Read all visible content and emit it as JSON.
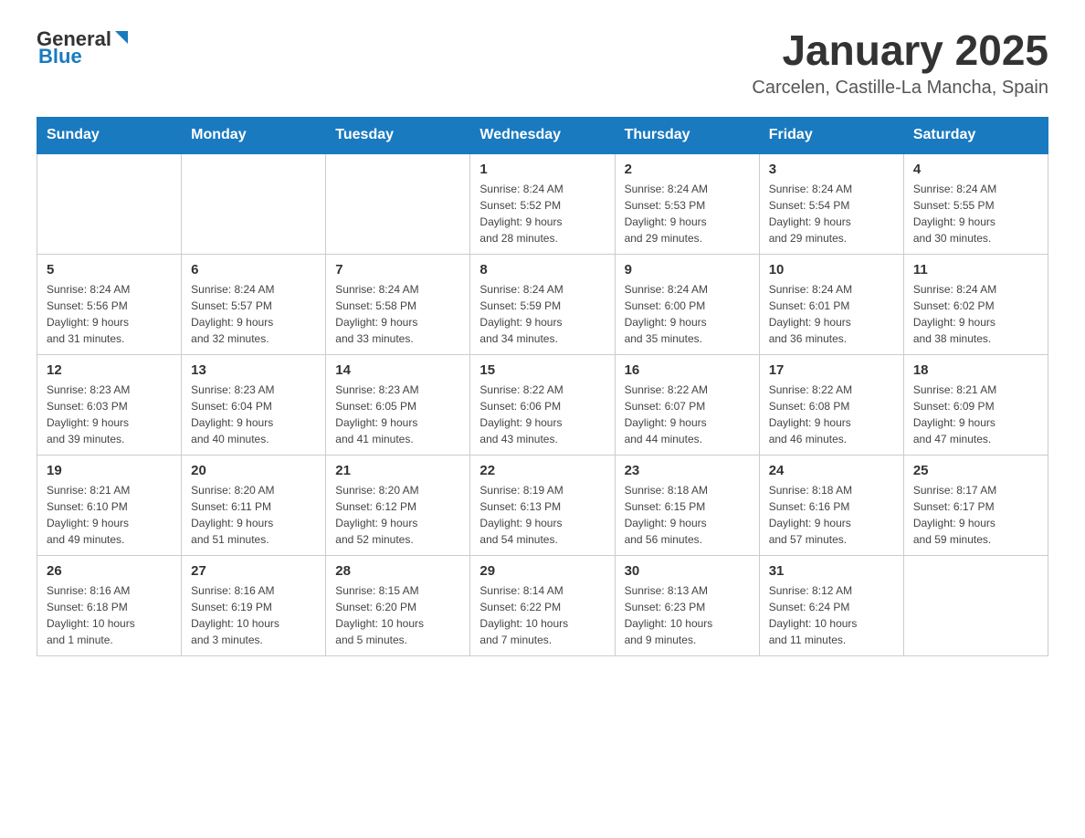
{
  "header": {
    "logo_text_general": "General",
    "logo_text_blue": "Blue",
    "title": "January 2025",
    "subtitle": "Carcelen, Castille-La Mancha, Spain"
  },
  "weekdays": [
    "Sunday",
    "Monday",
    "Tuesday",
    "Wednesday",
    "Thursday",
    "Friday",
    "Saturday"
  ],
  "weeks": [
    [
      {
        "day": "",
        "info": ""
      },
      {
        "day": "",
        "info": ""
      },
      {
        "day": "",
        "info": ""
      },
      {
        "day": "1",
        "info": "Sunrise: 8:24 AM\nSunset: 5:52 PM\nDaylight: 9 hours\nand 28 minutes."
      },
      {
        "day": "2",
        "info": "Sunrise: 8:24 AM\nSunset: 5:53 PM\nDaylight: 9 hours\nand 29 minutes."
      },
      {
        "day": "3",
        "info": "Sunrise: 8:24 AM\nSunset: 5:54 PM\nDaylight: 9 hours\nand 29 minutes."
      },
      {
        "day": "4",
        "info": "Sunrise: 8:24 AM\nSunset: 5:55 PM\nDaylight: 9 hours\nand 30 minutes."
      }
    ],
    [
      {
        "day": "5",
        "info": "Sunrise: 8:24 AM\nSunset: 5:56 PM\nDaylight: 9 hours\nand 31 minutes."
      },
      {
        "day": "6",
        "info": "Sunrise: 8:24 AM\nSunset: 5:57 PM\nDaylight: 9 hours\nand 32 minutes."
      },
      {
        "day": "7",
        "info": "Sunrise: 8:24 AM\nSunset: 5:58 PM\nDaylight: 9 hours\nand 33 minutes."
      },
      {
        "day": "8",
        "info": "Sunrise: 8:24 AM\nSunset: 5:59 PM\nDaylight: 9 hours\nand 34 minutes."
      },
      {
        "day": "9",
        "info": "Sunrise: 8:24 AM\nSunset: 6:00 PM\nDaylight: 9 hours\nand 35 minutes."
      },
      {
        "day": "10",
        "info": "Sunrise: 8:24 AM\nSunset: 6:01 PM\nDaylight: 9 hours\nand 36 minutes."
      },
      {
        "day": "11",
        "info": "Sunrise: 8:24 AM\nSunset: 6:02 PM\nDaylight: 9 hours\nand 38 minutes."
      }
    ],
    [
      {
        "day": "12",
        "info": "Sunrise: 8:23 AM\nSunset: 6:03 PM\nDaylight: 9 hours\nand 39 minutes."
      },
      {
        "day": "13",
        "info": "Sunrise: 8:23 AM\nSunset: 6:04 PM\nDaylight: 9 hours\nand 40 minutes."
      },
      {
        "day": "14",
        "info": "Sunrise: 8:23 AM\nSunset: 6:05 PM\nDaylight: 9 hours\nand 41 minutes."
      },
      {
        "day": "15",
        "info": "Sunrise: 8:22 AM\nSunset: 6:06 PM\nDaylight: 9 hours\nand 43 minutes."
      },
      {
        "day": "16",
        "info": "Sunrise: 8:22 AM\nSunset: 6:07 PM\nDaylight: 9 hours\nand 44 minutes."
      },
      {
        "day": "17",
        "info": "Sunrise: 8:22 AM\nSunset: 6:08 PM\nDaylight: 9 hours\nand 46 minutes."
      },
      {
        "day": "18",
        "info": "Sunrise: 8:21 AM\nSunset: 6:09 PM\nDaylight: 9 hours\nand 47 minutes."
      }
    ],
    [
      {
        "day": "19",
        "info": "Sunrise: 8:21 AM\nSunset: 6:10 PM\nDaylight: 9 hours\nand 49 minutes."
      },
      {
        "day": "20",
        "info": "Sunrise: 8:20 AM\nSunset: 6:11 PM\nDaylight: 9 hours\nand 51 minutes."
      },
      {
        "day": "21",
        "info": "Sunrise: 8:20 AM\nSunset: 6:12 PM\nDaylight: 9 hours\nand 52 minutes."
      },
      {
        "day": "22",
        "info": "Sunrise: 8:19 AM\nSunset: 6:13 PM\nDaylight: 9 hours\nand 54 minutes."
      },
      {
        "day": "23",
        "info": "Sunrise: 8:18 AM\nSunset: 6:15 PM\nDaylight: 9 hours\nand 56 minutes."
      },
      {
        "day": "24",
        "info": "Sunrise: 8:18 AM\nSunset: 6:16 PM\nDaylight: 9 hours\nand 57 minutes."
      },
      {
        "day": "25",
        "info": "Sunrise: 8:17 AM\nSunset: 6:17 PM\nDaylight: 9 hours\nand 59 minutes."
      }
    ],
    [
      {
        "day": "26",
        "info": "Sunrise: 8:16 AM\nSunset: 6:18 PM\nDaylight: 10 hours\nand 1 minute."
      },
      {
        "day": "27",
        "info": "Sunrise: 8:16 AM\nSunset: 6:19 PM\nDaylight: 10 hours\nand 3 minutes."
      },
      {
        "day": "28",
        "info": "Sunrise: 8:15 AM\nSunset: 6:20 PM\nDaylight: 10 hours\nand 5 minutes."
      },
      {
        "day": "29",
        "info": "Sunrise: 8:14 AM\nSunset: 6:22 PM\nDaylight: 10 hours\nand 7 minutes."
      },
      {
        "day": "30",
        "info": "Sunrise: 8:13 AM\nSunset: 6:23 PM\nDaylight: 10 hours\nand 9 minutes."
      },
      {
        "day": "31",
        "info": "Sunrise: 8:12 AM\nSunset: 6:24 PM\nDaylight: 10 hours\nand 11 minutes."
      },
      {
        "day": "",
        "info": ""
      }
    ]
  ]
}
